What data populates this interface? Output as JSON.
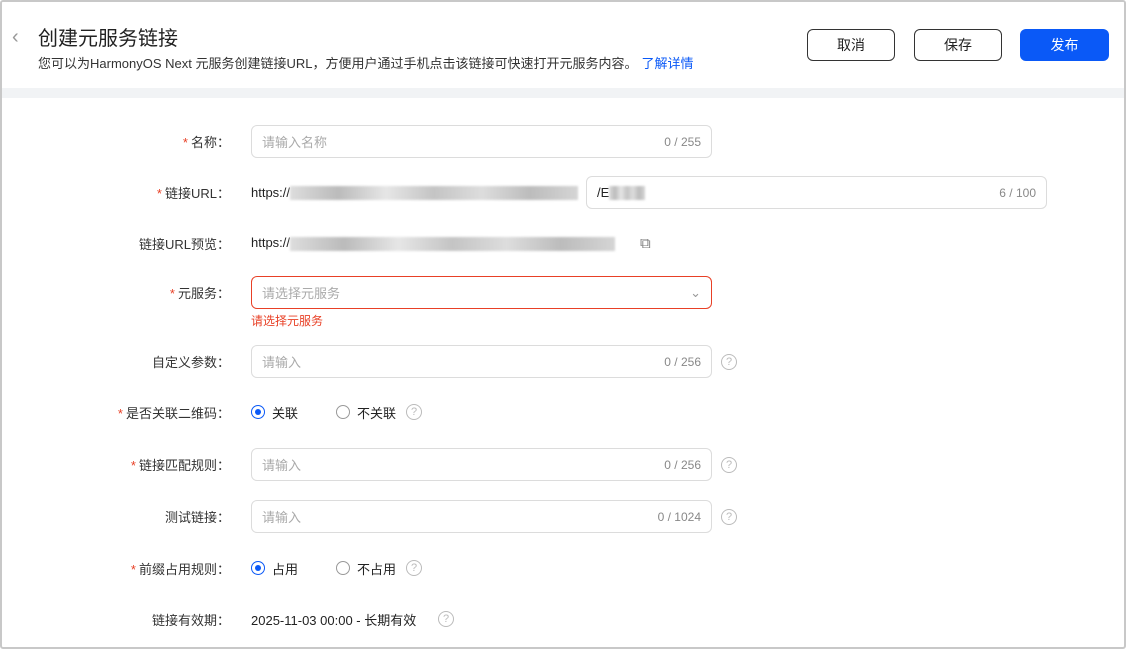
{
  "header": {
    "title": "创建元服务链接",
    "description": "您可以为HarmonyOS Next 元服务创建链接URL，方便用户通过手机点击该链接可快速打开元服务内容。",
    "learn_more": "了解详情",
    "cancel": "取消",
    "save": "保存",
    "publish": "发布"
  },
  "form": {
    "name": {
      "label": "名称：",
      "placeholder": "请输入名称",
      "count": "0 / 255"
    },
    "url": {
      "label": "链接URL：",
      "prefix": "https://",
      "value": "/E",
      "count": "6 / 100"
    },
    "preview": {
      "label": "链接URL预览：",
      "prefix": "https://"
    },
    "service": {
      "label": "元服务：",
      "placeholder": "请选择元服务",
      "error": "请选择元服务"
    },
    "params": {
      "label": "自定义参数：",
      "placeholder": "请输入",
      "count": "0 / 256"
    },
    "qr": {
      "label": "是否关联二维码：",
      "opt1": "关联",
      "opt2": "不关联"
    },
    "rule": {
      "label": "链接匹配规则：",
      "placeholder": "请输入",
      "count": "0 / 256"
    },
    "test": {
      "label": "测试链接：",
      "placeholder": "请输入",
      "count": "0 / 1024"
    },
    "prefix": {
      "label": "前缀占用规则：",
      "opt1": "占用",
      "opt2": "不占用"
    },
    "validity": {
      "label": "链接有效期：",
      "value": "2025-11-03 00:00 - 长期有效"
    }
  }
}
